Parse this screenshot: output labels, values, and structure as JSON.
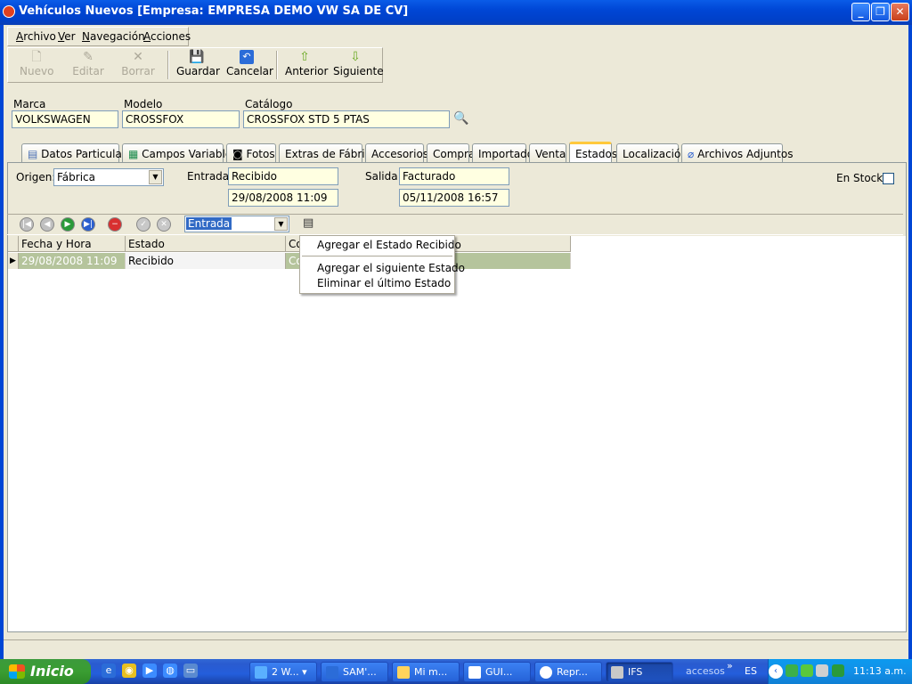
{
  "window": {
    "title": "Vehículos Nuevos [Empresa: EMPRESA DEMO VW SA DE CV]"
  },
  "menu": [
    "Archivo",
    "Ver",
    "Navegación",
    "Acciones"
  ],
  "toolbar": {
    "nuevo": "Nuevo",
    "editar": "Editar",
    "borrar": "Borrar",
    "guardar": "Guardar",
    "cancelar": "Cancelar",
    "anterior": "Anterior",
    "siguiente": "Siguiente"
  },
  "vehicle": {
    "marca_label": "Marca",
    "marca": "VOLKSWAGEN",
    "modelo_label": "Modelo",
    "modelo": "CROSSFOX",
    "catalogo_label": "Catálogo",
    "catalogo": "CROSSFOX  STD 5 PTAS"
  },
  "tabs": [
    "Datos Particulares",
    "Campos Variables",
    "Fotos",
    "Extras de Fábrica",
    "Accesorios",
    "Compra",
    "Importado",
    "Venta",
    "Estados",
    "Localización",
    "Archivos Adjuntos"
  ],
  "active_tab": "Estados",
  "estados": {
    "origen_label": "Origen:",
    "origen": "Fábrica",
    "entrada_label": "Entrada:",
    "entrada_estado": "Recibido",
    "entrada_fecha": "29/08/2008 11:09",
    "salida_label": "Salida:",
    "salida_estado": "Facturado",
    "salida_fecha": "05/11/2008 16:57",
    "en_stock_label": "En Stock",
    "grid_filter": "Entrada"
  },
  "grid": {
    "columns": [
      "Fecha y Hora",
      "Estado",
      "Co"
    ],
    "rows": [
      {
        "fecha": "29/08/2008 11:09",
        "estado": "Recibido",
        "co": "Co"
      }
    ]
  },
  "context_menu": [
    "Agregar el Estado Recibido",
    "Agregar el siguiente Estado",
    "Eliminar el último Estado"
  ],
  "taskbar": {
    "start": "Inicio",
    "tasks": [
      "2 W...",
      "SAM'...",
      "Mi m...",
      "GUI...",
      "Repr...",
      "IFS"
    ],
    "accesos": "accesos",
    "lang": "ES",
    "clock": "11:13 a.m."
  },
  "colors": {
    "title_bar": "#0046d5",
    "tab_highlight": "#ffc83c",
    "field_bg": "#ffffe1",
    "row_highlight": "#b5c49c"
  }
}
